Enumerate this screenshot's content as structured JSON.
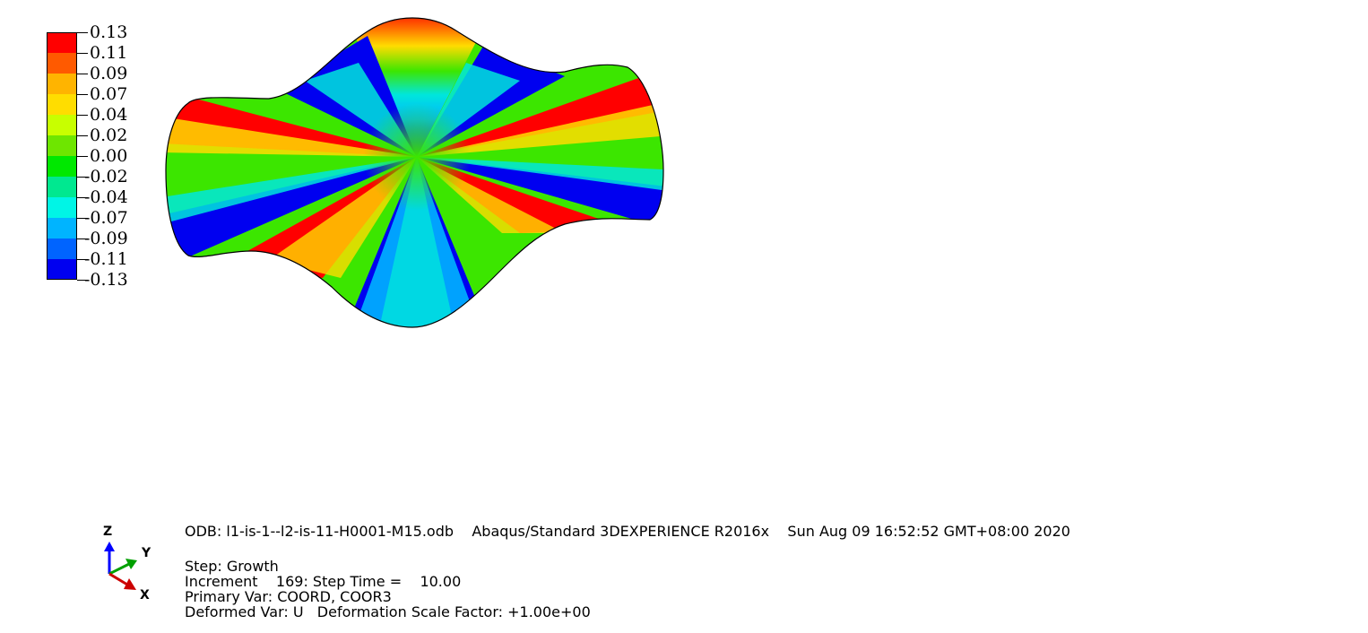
{
  "legend": {
    "title": "",
    "labels": [
      "0.13",
      "0.11",
      "0.09",
      "0.07",
      "0.04",
      "0.02",
      "0.00",
      "-0.02",
      "-0.04",
      "-0.07",
      "-0.09",
      "-0.11",
      "-0.13"
    ],
    "colors": [
      "#ff0000",
      "#ff5a00",
      "#ffb400",
      "#ffdd00",
      "#c8ff00",
      "#6ee600",
      "#00e800",
      "#00e890",
      "#00f5e6",
      "#00b4ff",
      "#0064ff",
      "#0000f0"
    ]
  },
  "model_view": {
    "name": "deformed-plate-contour",
    "colors": {
      "red": "#ff0000",
      "orange": "#ff6400",
      "yellow": "#ffdc00",
      "green": "#3ce600",
      "cyan": "#00e6dc",
      "blue": "#0000f0"
    }
  },
  "triad": {
    "z_label": "Z",
    "y_label": "Y",
    "x_label": "X",
    "colors": {
      "z": "#0000ff",
      "y": "#00a000",
      "x": "#cc0000"
    }
  },
  "info": {
    "odb_line": "ODB: l1-is-1--l2-is-11-H0001-M15.odb    Abaqus/Standard 3DEXPERIENCE R2016x    Sun Aug 09 16:52:52 GMT+08:00 2020",
    "step_line": "Step: Growth",
    "increment_line": "Increment    169: Step Time =    10.00",
    "primary_var_line": "Primary Var: COORD, COOR3",
    "deformed_var_line": "Deformed Var: U   Deformation Scale Factor: +1.00e+00"
  }
}
